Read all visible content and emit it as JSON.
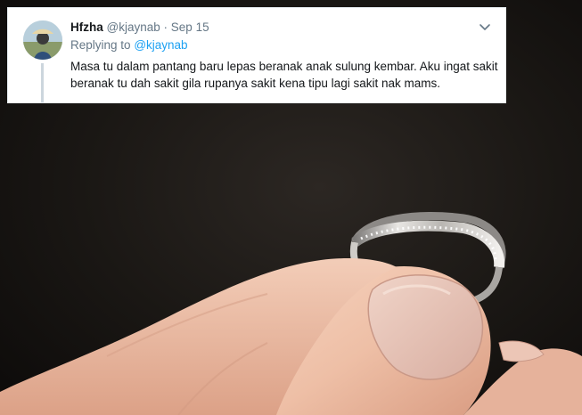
{
  "tweet": {
    "display_name": "Hfzha",
    "handle": "@kjaynab",
    "separator": "·",
    "date": "Sep 15",
    "replying_prefix": "Replying to",
    "replying_to": "@kjaynab",
    "text": "Masa tu dalam pantang baru lepas beranak anak sulung kembar. Aku ingat sakit beranak tu dah sakit gila rupanya sakit kena tipu lagi sakit nak mams.",
    "more_icon": "chevron-down-icon",
    "avatar_icon": "avatar"
  },
  "colors": {
    "mention": "#1da1f2",
    "secondary_text": "#657786",
    "primary_text": "#14171a",
    "card_bg": "#ffffff"
  }
}
